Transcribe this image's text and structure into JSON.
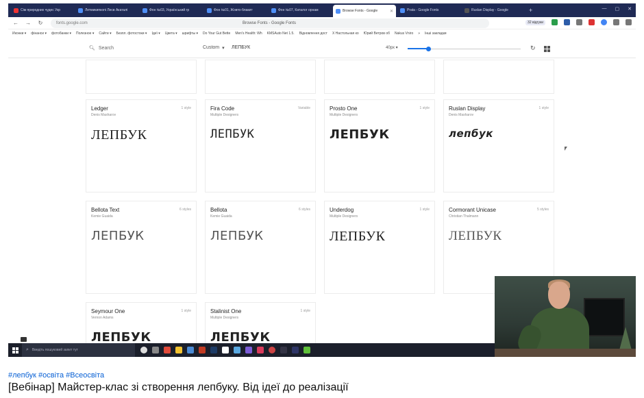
{
  "browser": {
    "tabs": [
      {
        "label": "Сім природних чудес Укр",
        "favicon": "red"
      },
      {
        "label": "Летмикипкопі Лесв Акаталі",
        "favicon": "blue"
      },
      {
        "label": "Фон №03, Український гр",
        "favicon": "blue"
      },
      {
        "label": "Фон №01, Жовто-блакит",
        "favicon": "blue"
      },
      {
        "label": "Фон №07, Каталог орнам",
        "favicon": "blue"
      },
      {
        "label": "Browse Fonts - Google",
        "favicon": "blue",
        "active": true
      },
      {
        "label": "Prata - Google Fonts",
        "favicon": "blue"
      },
      {
        "label": "Ruslan Display - Google",
        "favicon": "dark"
      }
    ],
    "url": "fonts.google.com",
    "page_title": "Browse Fonts - Google Fonts",
    "extension_badge": "32 відгуки",
    "bookmarks": [
      "Иконки ▾",
      "фінанси ▾",
      "фотобанки ▾",
      "Полезное ▾",
      "Сайти ▾",
      "Безпл. фотостоки ▾",
      "Ідеї ▾",
      "Цвета ▾",
      "шрифты ▾",
      "Do Your Gut Bette",
      "Men's Health: Wh",
      "KMSAuto Net 1.5.",
      "Відновлення дост",
      "Х Настольная ко",
      "Юрий Ветров об",
      "Nakus Vniro",
      "»",
      "Інші закладки"
    ]
  },
  "fonts_toolbar": {
    "search_placeholder": "Search",
    "mode": "Custom",
    "preview_text": "ЛЕПБУК",
    "size": "40px",
    "slider_fraction": 0.18
  },
  "font_cards": [
    {
      "name": "Ledger",
      "designer": "Denis Masharov",
      "styles": "1 style",
      "sample": "ЛЕПБУК",
      "variant": "serif"
    },
    {
      "name": "Fira Code",
      "designer": "Multiple Designers",
      "styles": "Variable",
      "sample": "ЛЕПБУК",
      "variant": "mono"
    },
    {
      "name": "Prosto One",
      "designer": "Multiple Designers",
      "styles": "1 style",
      "sample": "ЛЕПБУК",
      "variant": "bold"
    },
    {
      "name": "Ruslan Display",
      "designer": "Denis Masharov",
      "styles": "1 style",
      "sample": "лепбук",
      "variant": "black"
    },
    {
      "name": "Bellota Text",
      "designer": "Kemie Guaida",
      "styles": "6 styles",
      "sample": "ЛЕПБУК",
      "variant": "light"
    },
    {
      "name": "Bellota",
      "designer": "Kemie Guaida",
      "styles": "6 styles",
      "sample": "ЛЕПБУК",
      "variant": "light"
    },
    {
      "name": "Underdog",
      "designer": "Multiple Designers",
      "styles": "1 style",
      "sample": "ЛЕПБУК",
      "variant": "serif"
    },
    {
      "name": "Cormorant Unicase",
      "designer": "Christian Thalmann",
      "styles": "5 styles",
      "sample": "ЛЕПБУК",
      "variant": "serif-light"
    },
    {
      "name": "Seymour One",
      "designer": "Vernon Adams",
      "styles": "1 style",
      "sample": "ЛЕПБУК",
      "variant": "heavy"
    },
    {
      "name": "Stalinist One",
      "designer": "Multiple Designers",
      "styles": "1 style",
      "sample": "ЛЕПБУК",
      "variant": "heavy"
    }
  ],
  "taskbar": {
    "search_placeholder": "Введіть пошуковий запит тут"
  },
  "video": {
    "hashtags": "#лепбук #освіта #Всеосвіта",
    "title": "[Вебінар] Майстер-клас зі створення лепбуку. Від ідеї до реалізації"
  },
  "colors": {
    "tabstrip": "#1f2a55",
    "accent": "#1a73e8",
    "hashtag": "#065fd4",
    "taskbar": "#1b1f2b"
  }
}
